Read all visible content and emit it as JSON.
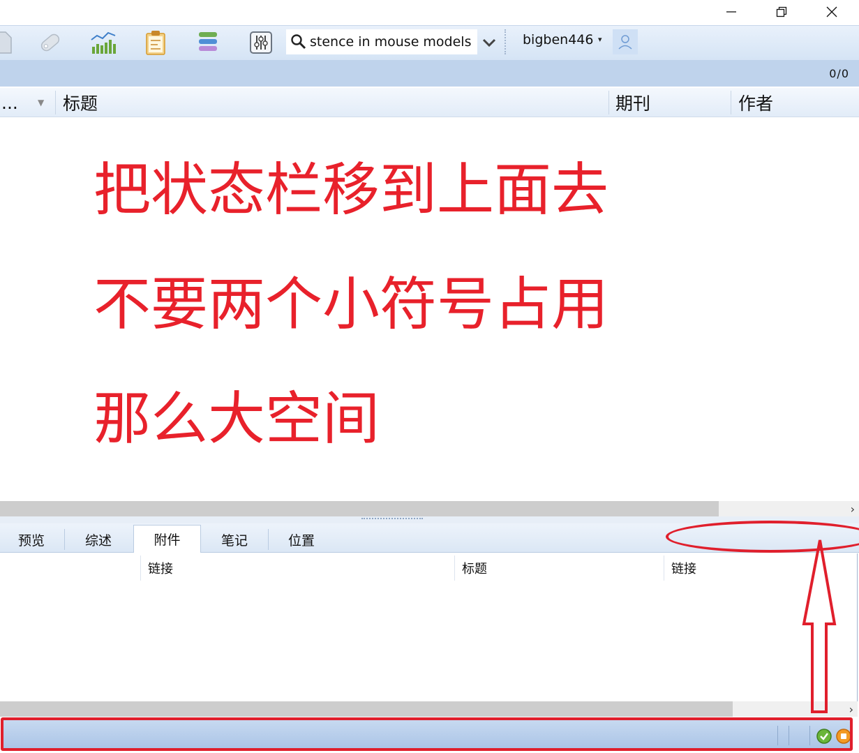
{
  "window": {
    "minimize_glyph": "—",
    "restore_glyph": "❐",
    "close_glyph": "✕"
  },
  "toolbar": {
    "icons": [
      "document-icon",
      "tag-icon",
      "chart-icon",
      "clipboard-icon",
      "stack-icon",
      "equalizer-icon"
    ],
    "search": {
      "value": "stence in mouse models"
    },
    "username": "bigben446",
    "user_dropdown_glyph": "▾"
  },
  "list": {
    "count": "0/0",
    "columns": [
      {
        "label": "..."
      },
      {
        "label": "标题"
      },
      {
        "label": "期刊"
      },
      {
        "label": "作者"
      }
    ]
  },
  "annotation": {
    "lines": [
      "把状态栏移到上面去",
      "不要两个小符号占用",
      "那么大空间"
    ]
  },
  "bottom_tabs": {
    "tabs": [
      "预览",
      "综述",
      "附件",
      "笔记",
      "位置"
    ],
    "active": "附件"
  },
  "attachments": {
    "columns": [
      "链接",
      "标题",
      "链接"
    ]
  },
  "scroll": {
    "arrow_glyph": "›"
  },
  "colors": {
    "annotation_red": "#e8212b",
    "toolbar_blue": "#d5e4f5",
    "status_blue": "#a9c3e6"
  }
}
